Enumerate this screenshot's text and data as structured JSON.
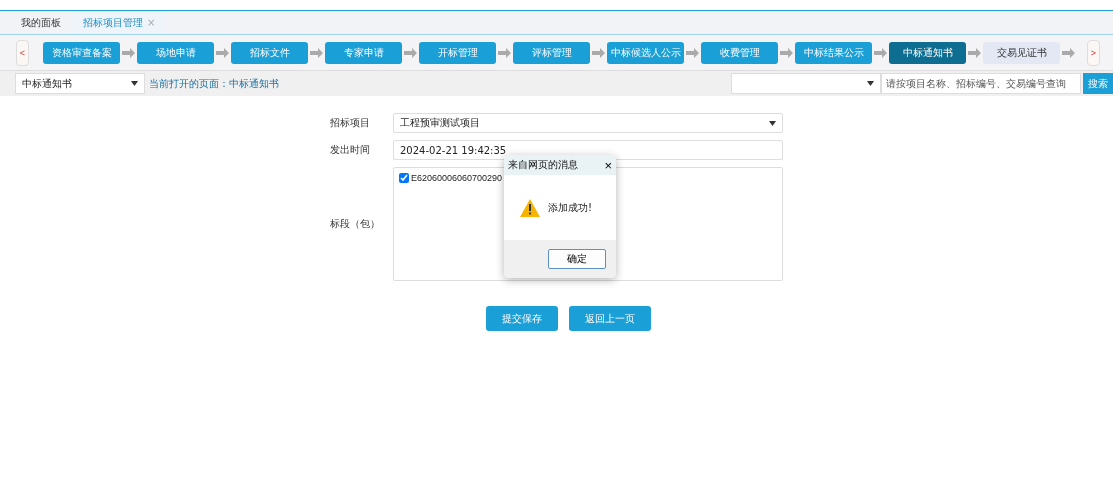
{
  "tabs": [
    {
      "label": "我的面板",
      "selected": false
    },
    {
      "label": "招标项目管理",
      "selected": true,
      "close": "×"
    }
  ],
  "steps_nav": {
    "prev": "<",
    "next": ">"
  },
  "steps": [
    {
      "label": "资格审查备案",
      "selected": false,
      "disabled": false
    },
    {
      "label": "场地申请",
      "selected": false,
      "disabled": false
    },
    {
      "label": "招标文件",
      "selected": false,
      "disabled": false
    },
    {
      "label": "专家申请",
      "selected": false,
      "disabled": false
    },
    {
      "label": "开标管理",
      "selected": false,
      "disabled": false
    },
    {
      "label": "评标管理",
      "selected": false,
      "disabled": false
    },
    {
      "label": "中标候选人公示",
      "selected": false,
      "disabled": false
    },
    {
      "label": "收费管理",
      "selected": false,
      "disabled": false
    },
    {
      "label": "中标结果公示",
      "selected": false,
      "disabled": false
    },
    {
      "label": "中标通知书",
      "selected": true,
      "disabled": false
    },
    {
      "label": "交易见证书",
      "selected": false,
      "disabled": true
    }
  ],
  "filter_bar": {
    "page_select": "中标通知书",
    "current_page": "当前打开的页面：中标通知书",
    "search_placeholder": "请按项目名称、招标编号、交易编号查询",
    "search_button": "搜索"
  },
  "form": {
    "project_label": "招标项目",
    "project_value": "工程预审测试项目",
    "time_label": "发出时间",
    "time_value": "2024-02-21 19:42:35",
    "section_label": "标段（包）",
    "sections": [
      {
        "code": "E62060006060700290",
        "checked": true
      }
    ]
  },
  "buttons": [
    "提交保存",
    "返回上一页"
  ],
  "dialog": {
    "title": "来自网页的消息",
    "close": "×",
    "message": "添加成功!",
    "ok": "确定"
  }
}
